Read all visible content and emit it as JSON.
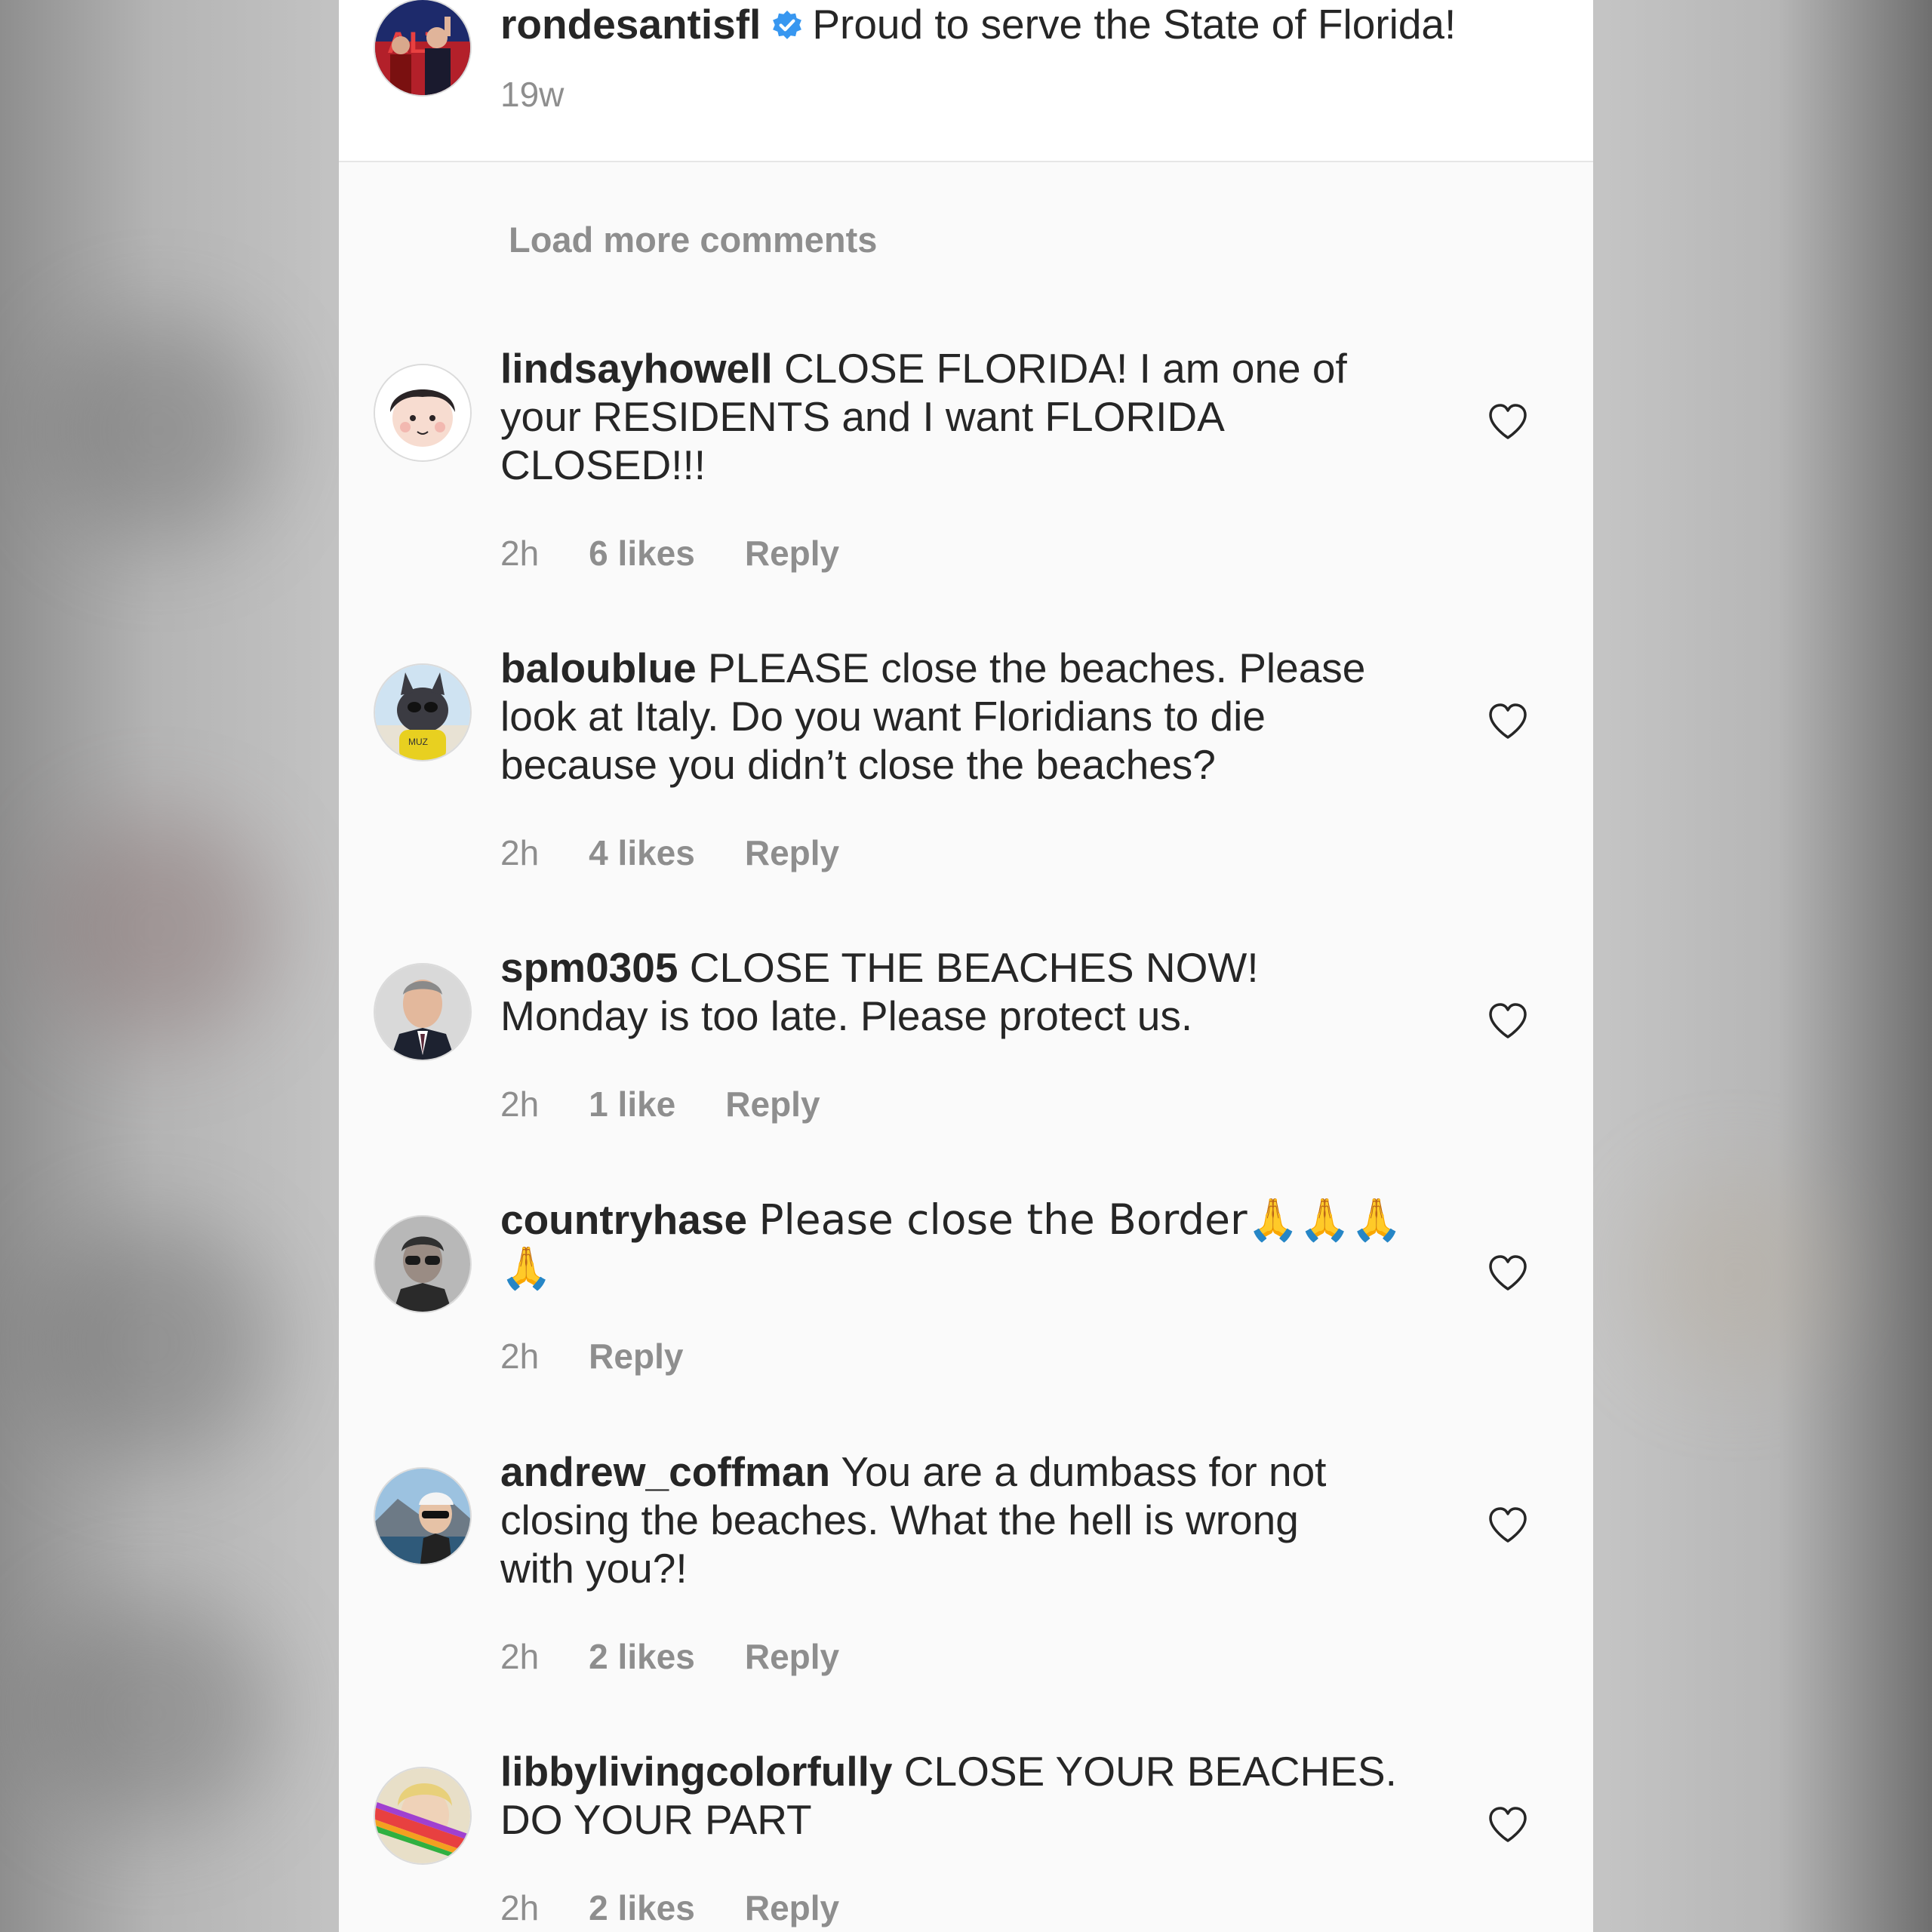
{
  "post": {
    "author": "rondesantisfl",
    "caption": "Proud to serve the State of Florida!",
    "age": "19w"
  },
  "load_more_label": "Load more comments",
  "reply_label": "Reply",
  "comments": [
    {
      "username": "lindsayhowell",
      "lines": [
        "CLOSE FLORIDA! I am one of",
        "your RESIDENTS and I want FLORIDA",
        "CLOSED!!!"
      ],
      "time": "2h",
      "likes": "6 likes"
    },
    {
      "username": "baloublue",
      "lines": [
        "PLEASE close the beaches. Please",
        "look at Italy. Do you want Floridians to die",
        "because you didn’t close the beaches?"
      ],
      "time": "2h",
      "likes": "4 likes"
    },
    {
      "username": "spm0305",
      "lines": [
        "CLOSE THE BEACHES NOW!",
        "Monday is too late.  Please protect us."
      ],
      "time": "2h",
      "likes": "1 like"
    },
    {
      "username": "countryhase",
      "lines": [
        "Please close the Border🙏🙏🙏",
        "🙏"
      ],
      "time": "2h",
      "likes": ""
    },
    {
      "username": "andrew_coffman",
      "lines": [
        "You are a dumbass for not",
        "closing the beaches. What the hell is wrong",
        "with you?!"
      ],
      "time": "2h",
      "likes": "2 likes"
    },
    {
      "username": "libbylivingcolorfully",
      "lines": [
        "CLOSE YOUR BEACHES.",
        "DO YOUR PART"
      ],
      "time": "2h",
      "likes": "2 likes"
    }
  ],
  "colors": {
    "text": "#262626",
    "muted": "#8e8e8e",
    "verified": "#3897f0",
    "panel": "#fafafa"
  }
}
